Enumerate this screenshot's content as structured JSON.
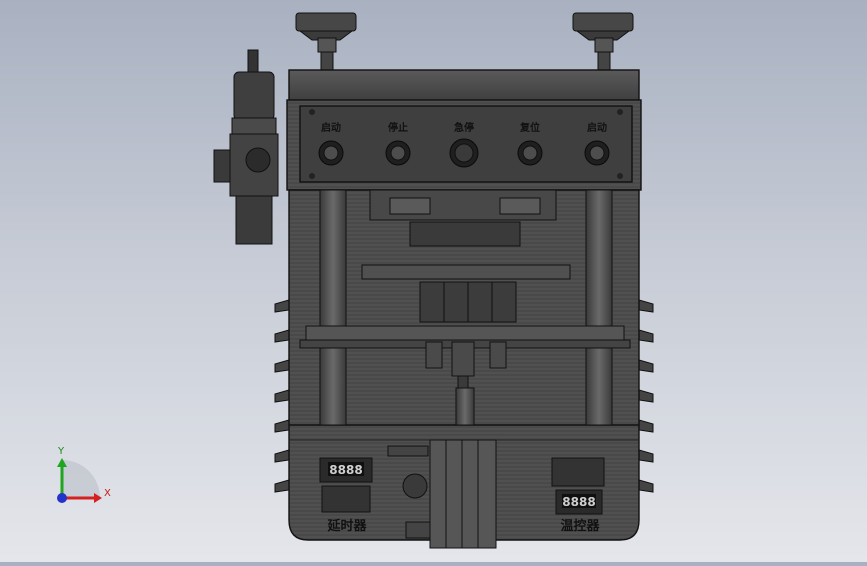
{
  "panel_buttons": [
    {
      "label": "启动",
      "type": "push"
    },
    {
      "label": "停止",
      "type": "push"
    },
    {
      "label": "急停",
      "type": "emergency"
    },
    {
      "label": "复位",
      "type": "push"
    },
    {
      "label": "启动",
      "type": "push"
    }
  ],
  "left_unit": {
    "label": "延时器",
    "display": "8888"
  },
  "right_unit": {
    "label": "温控器",
    "display": "8888"
  },
  "triad": {
    "x": "X",
    "y": "Y"
  },
  "colors": {
    "body": "#4f4f4f",
    "body_dark": "#2e2e2e",
    "edge": "#111111",
    "axis_x": "#d42020",
    "axis_y": "#1fa51f",
    "axis_z": "#2233cc"
  }
}
